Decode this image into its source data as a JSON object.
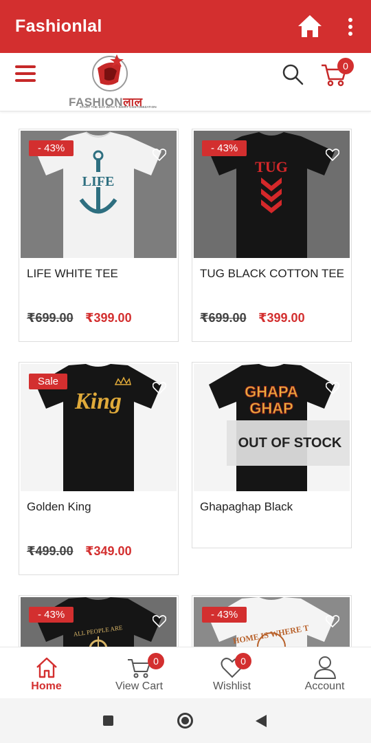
{
  "app": {
    "title": "Fashionlal"
  },
  "header": {
    "logo_text_a": "FASHION",
    "logo_text_b": "लाल",
    "logo_tagline": "START THE DAY WITH T-SHIRT CUSTOMIZATION",
    "cart_count": "0"
  },
  "products": [
    {
      "title": "LIFE WHITE TEE",
      "badge": "- 43%",
      "old_price": "₹699.00",
      "new_price": "₹399.00",
      "shirt_color": "#f2f2f2",
      "print_text": "LIFE",
      "print_color": "#2e6f80"
    },
    {
      "title": "TUG BLACK COTTON TEE",
      "badge": "- 43%",
      "old_price": "₹699.00",
      "new_price": "₹399.00",
      "shirt_color": "#151515",
      "print_text": "TUG",
      "print_color": "#d4282a"
    },
    {
      "title": "Golden King",
      "badge": "Sale",
      "old_price": "₹499.00",
      "new_price": "₹349.00",
      "shirt_color": "#151515",
      "print_text": "King",
      "print_color": "#e0aa3a"
    },
    {
      "title": "Ghapaghap Black",
      "badge": "",
      "old_price": "",
      "new_price": "",
      "stock_status": "OUT OF STOCK",
      "shirt_color": "#151515",
      "print_text": "GHAPA GHAP",
      "print_color": "#e8b440"
    },
    {
      "title": "",
      "badge": "- 43%",
      "shirt_color": "#151515",
      "print_text": "ALL PEOPLE ARE",
      "print_color": "#d9b668"
    },
    {
      "title": "",
      "badge": "- 43%",
      "shirt_color": "#f4f4f4",
      "print_text": "HOME IS WHERE T",
      "print_color": "#b8612a"
    }
  ],
  "bottom_nav": [
    {
      "label": "Home",
      "icon": "home-icon",
      "active": true
    },
    {
      "label": "View Cart",
      "icon": "cart-icon",
      "badge": "0"
    },
    {
      "label": "Wishlist",
      "icon": "heart-icon",
      "badge": "0"
    },
    {
      "label": "Account",
      "icon": "person-icon"
    }
  ],
  "colors": {
    "primary": "#d32f2f",
    "text": "#222222"
  }
}
